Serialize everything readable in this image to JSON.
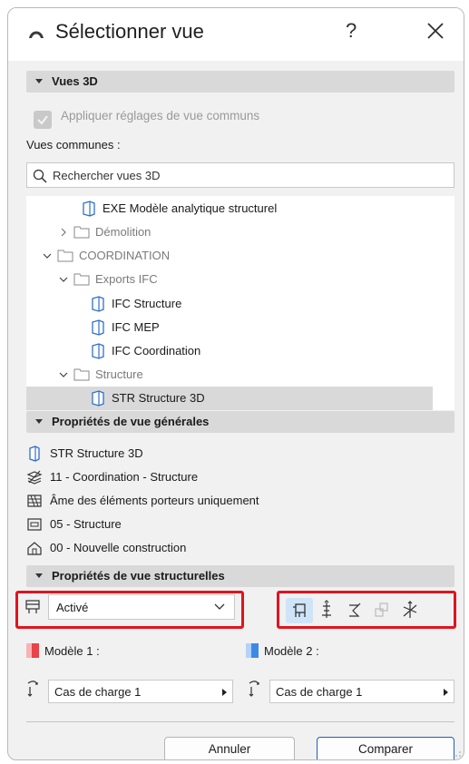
{
  "window": {
    "title": "Sélectionner vue",
    "help": "?"
  },
  "sections": {
    "views3d": "Vues 3D",
    "general": "Propriétés de vue générales",
    "structural": "Propriétés de vue structurelles"
  },
  "views3d": {
    "apply_common": "Appliquer réglages de vue communs",
    "common_label": "Vues communes :",
    "search_placeholder": "Rechercher vues 3D"
  },
  "tree": [
    {
      "label": "EXE Modèle analytique structurel",
      "type": "view",
      "level": 2,
      "muted": false
    },
    {
      "label": "Démolition",
      "type": "folder",
      "level": 1,
      "expanded": false,
      "muted": true
    },
    {
      "label": "COORDINATION",
      "type": "folder",
      "level": 0,
      "expanded": true,
      "muted": true
    },
    {
      "label": "Exports IFC",
      "type": "folder",
      "level": 1,
      "expanded": true,
      "muted": true
    },
    {
      "label": "IFC Structure",
      "type": "view",
      "level": 2,
      "muted": false
    },
    {
      "label": "IFC MEP",
      "type": "view",
      "level": 2,
      "muted": false
    },
    {
      "label": "IFC Coordination",
      "type": "view",
      "level": 2,
      "muted": false
    },
    {
      "label": "Structure",
      "type": "folder",
      "level": 1,
      "expanded": true,
      "muted": true
    },
    {
      "label": "STR Structure 3D",
      "type": "view",
      "level": 2,
      "muted": false,
      "selected": true
    }
  ],
  "general_props": [
    {
      "icon": "view-icon",
      "text": "STR Structure 3D"
    },
    {
      "icon": "layer-combination-icon",
      "text": "11 - Coordination - Structure"
    },
    {
      "icon": "structural-display-icon",
      "text": "Âme des éléments porteurs uniquement"
    },
    {
      "icon": "model-view-options-icon",
      "text": "05 - Structure"
    },
    {
      "icon": "renovation-filter-icon",
      "text": "00 - Nouvelle construction"
    }
  ],
  "structural": {
    "analytical_value": "Activé",
    "model1": "Modèle 1 :",
    "model2": "Modèle 2 :",
    "load1": "Cas de charge 1",
    "load2": "Cas de charge 1"
  },
  "colors": {
    "model1": "#e8424a",
    "model2": "#3d8ae6",
    "highlight": "#e0141e",
    "accent": "#1f5fb8"
  },
  "buttons": {
    "cancel": "Annuler",
    "compare": "Comparer"
  }
}
